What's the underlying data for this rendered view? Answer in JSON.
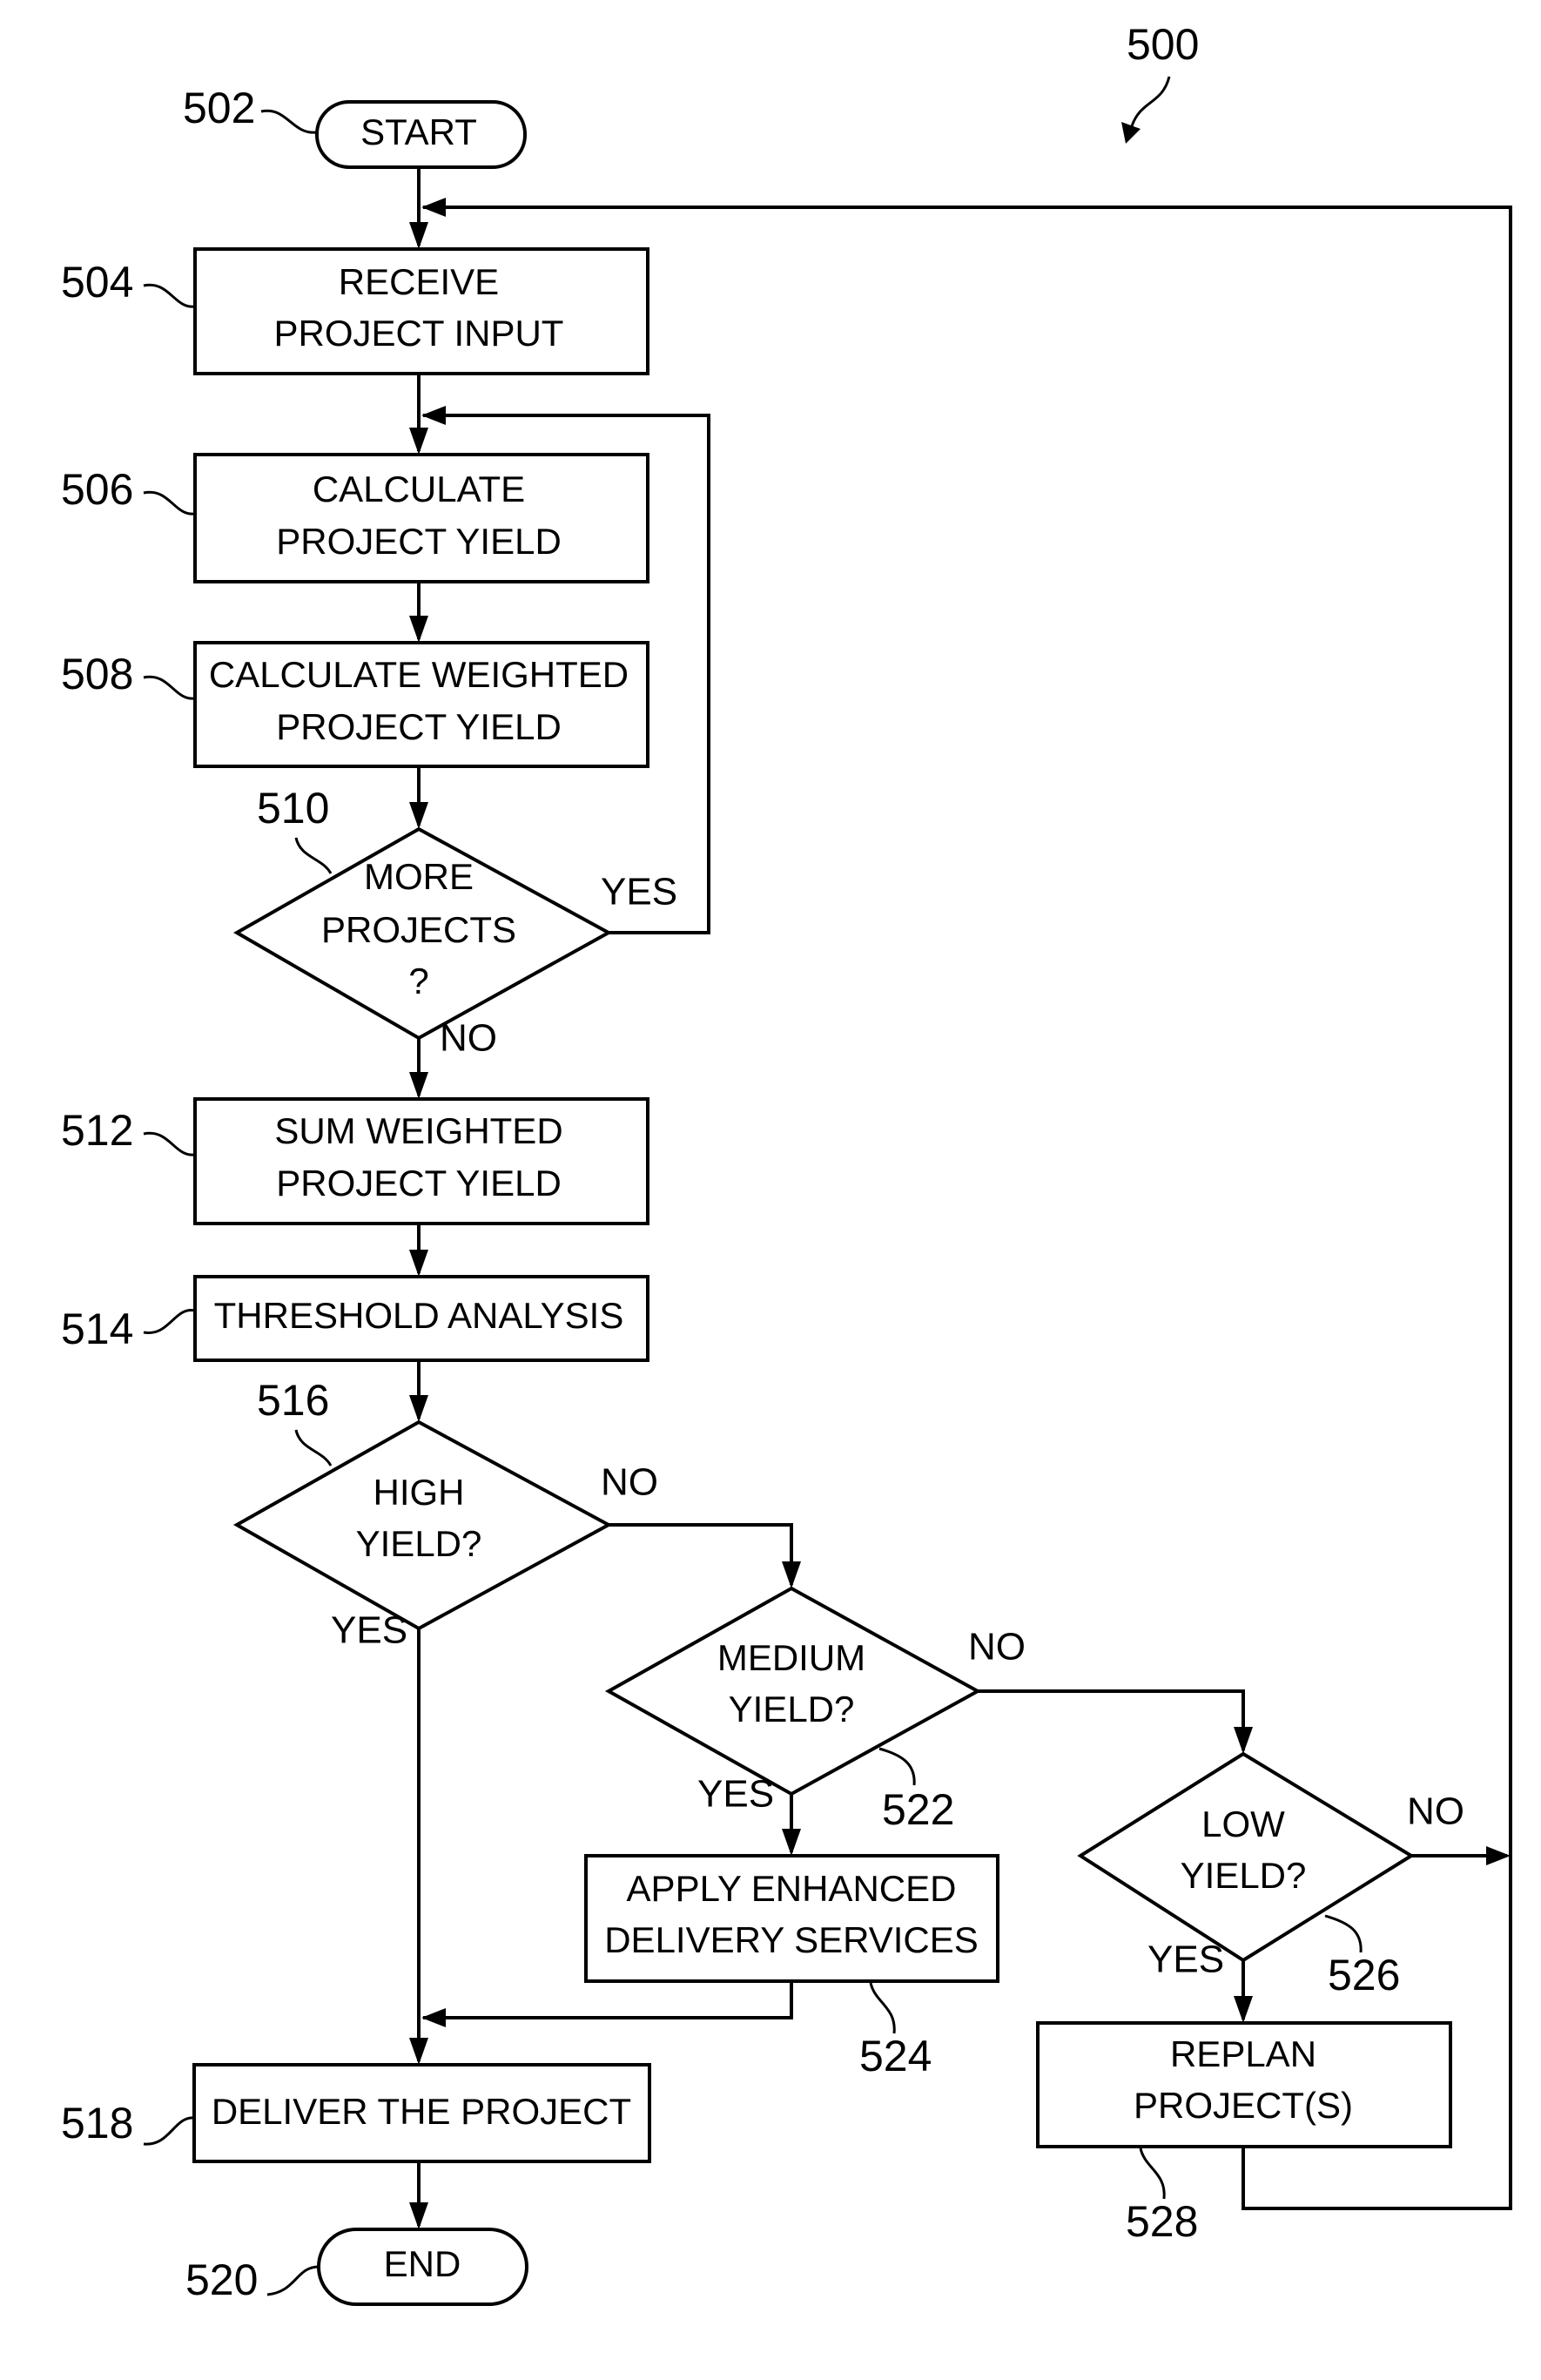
{
  "figure": {
    "reference": "500",
    "nodes": {
      "start": {
        "ref": "502",
        "lines": [
          "START"
        ]
      },
      "n504": {
        "ref": "504",
        "lines": [
          "RECEIVE",
          "PROJECT INPUT"
        ]
      },
      "n506": {
        "ref": "506",
        "lines": [
          "CALCULATE",
          "PROJECT YIELD"
        ]
      },
      "n508": {
        "ref": "508",
        "lines": [
          "CALCULATE WEIGHTED",
          "PROJECT YIELD"
        ]
      },
      "n510": {
        "ref": "510",
        "lines": [
          "MORE",
          "PROJECTS",
          "?"
        ]
      },
      "n512": {
        "ref": "512",
        "lines": [
          "SUM WEIGHTED",
          "PROJECT YIELD"
        ]
      },
      "n514": {
        "ref": "514",
        "lines": [
          "THRESHOLD ANALYSIS"
        ]
      },
      "n516": {
        "ref": "516",
        "lines": [
          "HIGH",
          "YIELD?"
        ]
      },
      "n518": {
        "ref": "518",
        "lines": [
          "DELIVER THE PROJECT"
        ]
      },
      "end": {
        "ref": "520",
        "lines": [
          "END"
        ]
      },
      "n522": {
        "ref": "522",
        "lines": [
          "MEDIUM",
          "YIELD?"
        ]
      },
      "n524": {
        "ref": "524",
        "lines": [
          "APPLY ENHANCED",
          "DELIVERY SERVICES"
        ]
      },
      "n526": {
        "ref": "526",
        "lines": [
          "LOW",
          "YIELD?"
        ]
      },
      "n528": {
        "ref": "528",
        "lines": [
          "REPLAN",
          "PROJECT(S)"
        ]
      }
    },
    "edge_labels": {
      "e510_yes": "YES",
      "e510_no": "NO",
      "e516_no": "NO",
      "e516_yes": "YES",
      "e522_no": "NO",
      "e522_yes": "YES",
      "e526_no": "NO",
      "e526_yes": "YES"
    }
  }
}
